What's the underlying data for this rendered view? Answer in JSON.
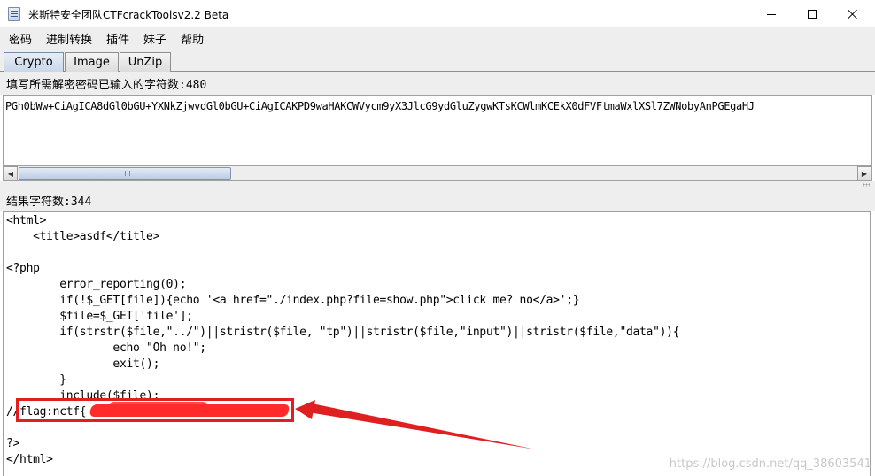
{
  "window": {
    "title": "米斯特安全团队CTFcrackToolsv2.2 Beta",
    "minimize_glyph": "—",
    "maximize_glyph": "☐",
    "close_glyph": "✕"
  },
  "menu": [
    "密码",
    "进制转换",
    "插件",
    "妹子",
    "帮助"
  ],
  "tabs": [
    {
      "label": "Crypto",
      "selected": true
    },
    {
      "label": "Image",
      "selected": false
    },
    {
      "label": "UnZip",
      "selected": false
    }
  ],
  "input": {
    "label": "填写所需解密密码",
    "count_label": "已输入的字符数:480",
    "text": "PGh0bWw+CiAgICA8dGl0bGU+YXNkZjwvdGl0bGU+CiAgICAKPD9waHAKCWVycm9yX3JlcG9ydGluZygwKTsKCWlmKCEkX0dFVFtmaWxlXSl7ZWNobyAnPGEgaHJ"
  },
  "result": {
    "label": "结果",
    "count_label": "字符数:344",
    "lines": [
      "<html>",
      "    <title>asdf</title>",
      "",
      "<?php",
      "        error_reporting(0);",
      "        if(!$_GET[file]){echo '<a href=\"./index.php?file=show.php\">click me? no</a>';}",
      "        $file=$_GET['file'];",
      "        if(strstr($file,\"../\")||stristr($file, \"tp\")||stristr($file,\"input\")||stristr($file,\"data\")){",
      "                echo \"Oh no!\";",
      "                exit();",
      "        }",
      "        include($file);",
      "//flag:nctf{",
      "",
      "?>",
      "</html>"
    ]
  },
  "watermark": "https://blog.csdn.net/qq_38603541",
  "colors": {
    "annotation_red": "#e02020",
    "chrome_gray": "#eeeeee"
  }
}
